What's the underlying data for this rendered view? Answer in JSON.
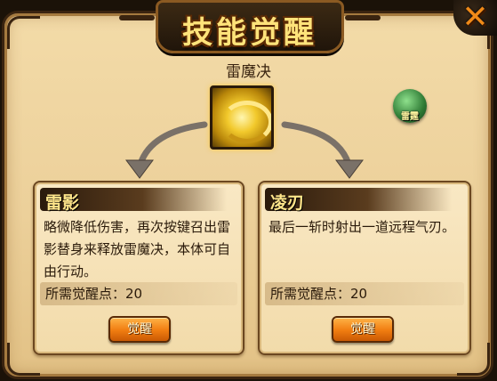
{
  "window": {
    "title": "技能觉醒",
    "close_icon": "close-x-icon"
  },
  "skill": {
    "name": "雷魔决",
    "icon": "golden-swirl-skill-icon",
    "element_badge": "雷霆"
  },
  "options": [
    {
      "name": "雷影",
      "description": "略微降低伤害，再次按键召出雷影替身来释放雷魔决，本体可自由行动。",
      "cost_text": "所需觉醒点：20",
      "button_label": "觉醒"
    },
    {
      "name": "凌刃",
      "description": "最后一斩时射出一道远程气刃。",
      "cost_text": "所需觉醒点：20",
      "button_label": "觉醒"
    }
  ],
  "colors": {
    "parchment": "#ecd09a",
    "frame_dark": "#3a2410",
    "title_gold": "#ffe37a",
    "button_orange": "#f07c10"
  }
}
